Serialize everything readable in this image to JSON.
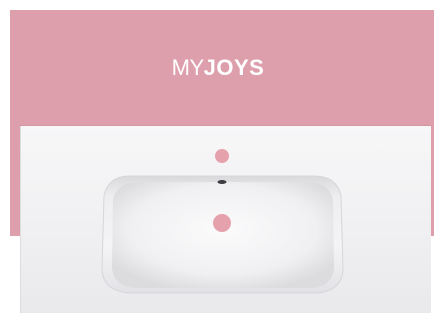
{
  "brand": {
    "prefix": "MY",
    "name": "JOYS"
  },
  "colors": {
    "backdrop": "#dd9fab",
    "hole_highlight": "#e5a2ad",
    "ceramic": "#f5f5f6"
  },
  "scene": {
    "subject": "white-ceramic-vanity-washbasin"
  }
}
